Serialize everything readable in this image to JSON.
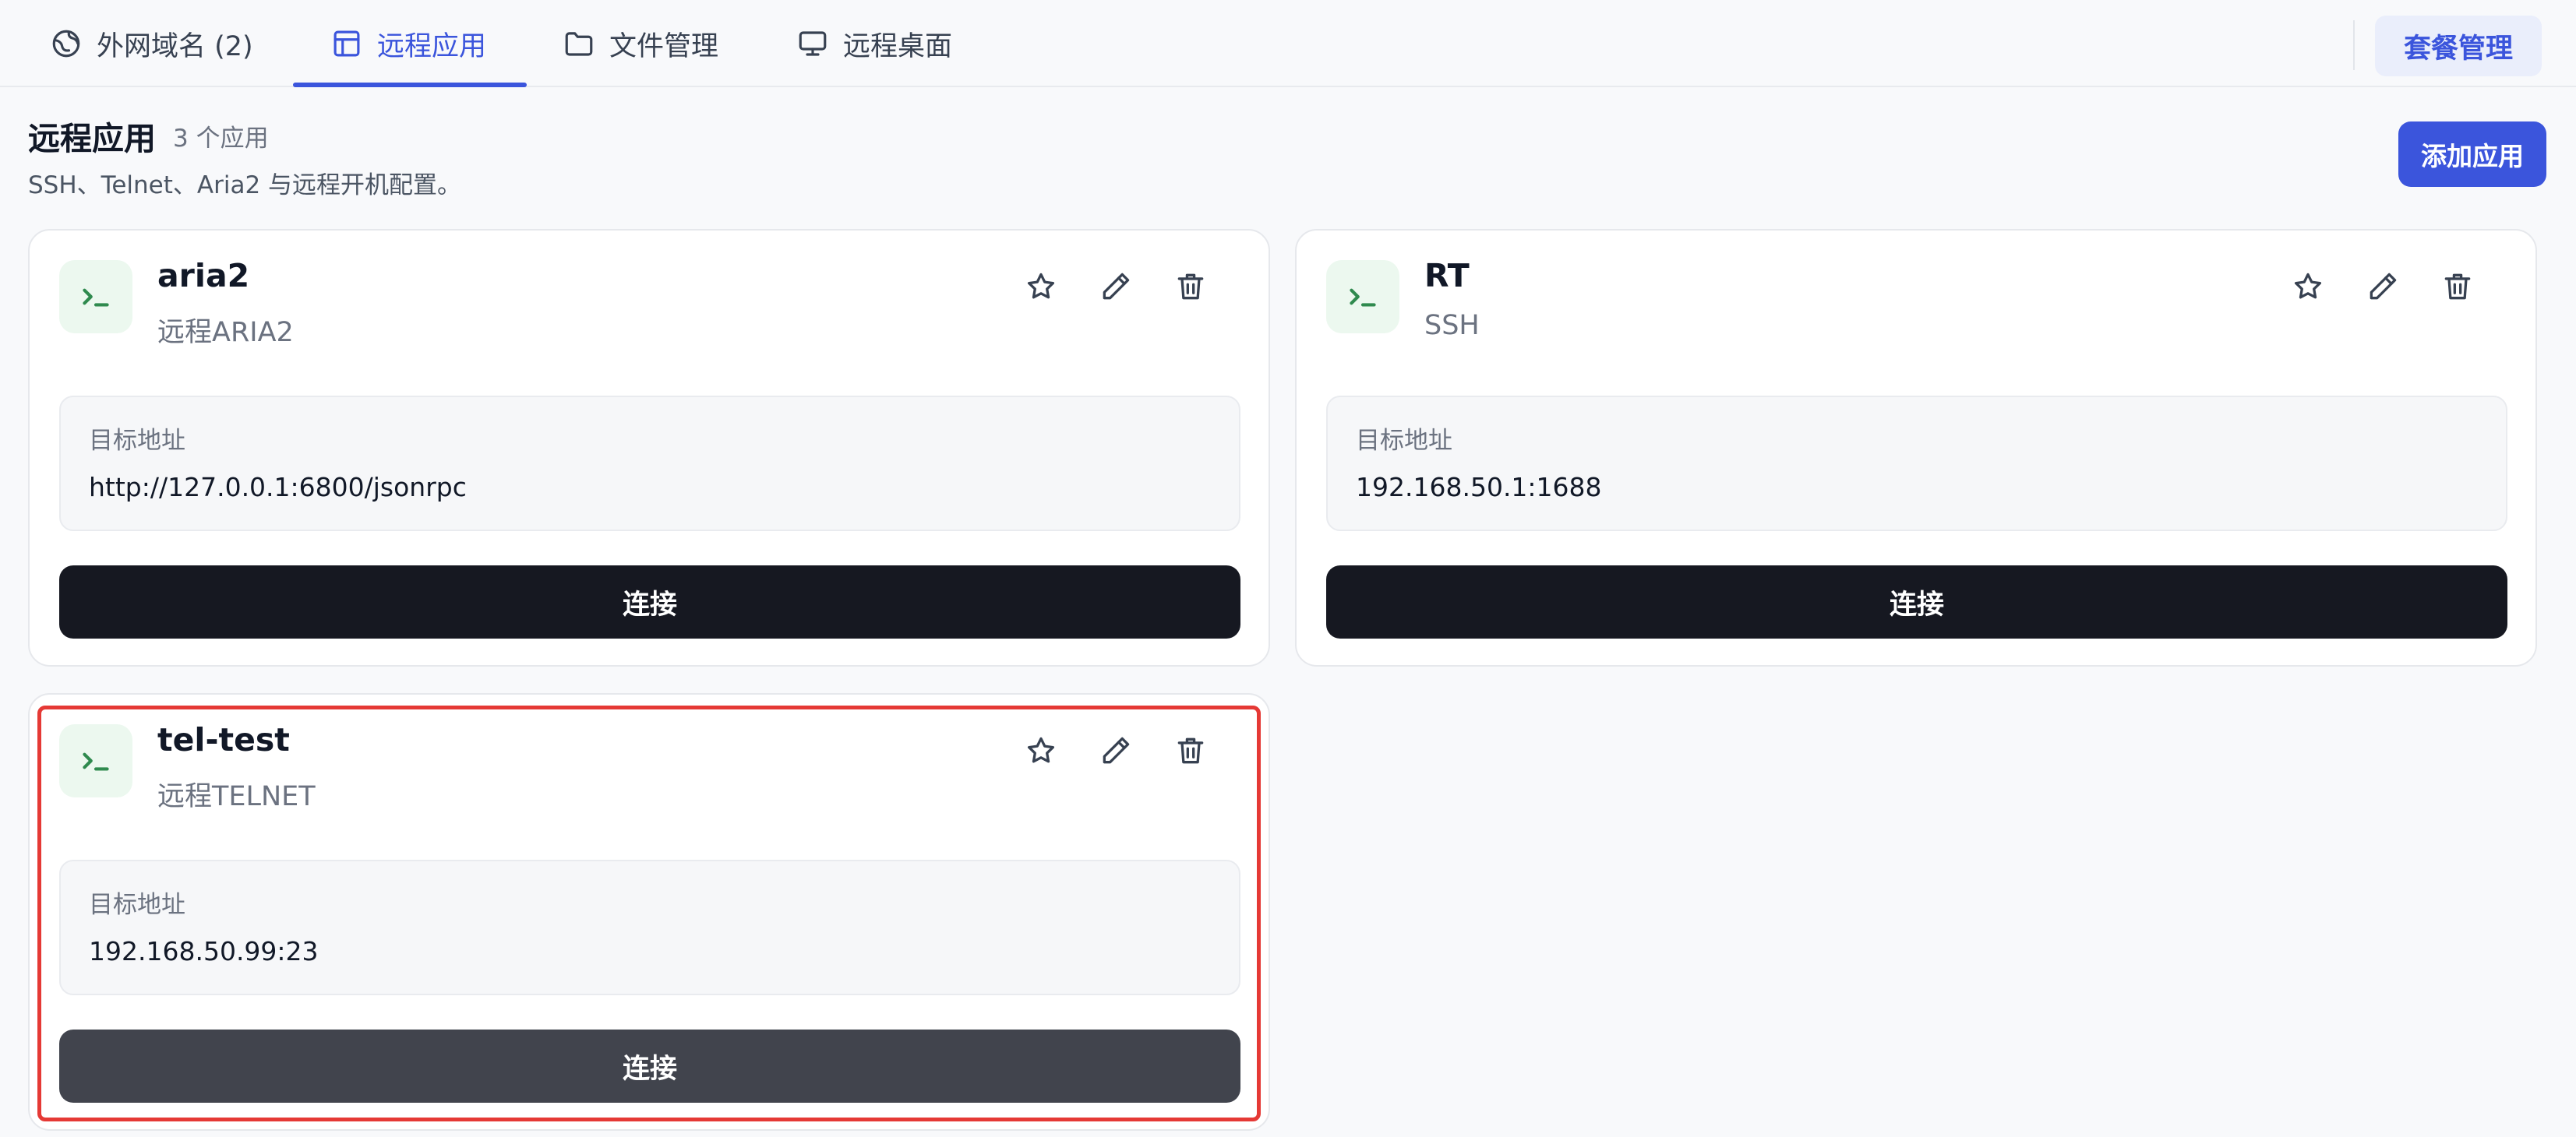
{
  "tabs": [
    {
      "label": "外网域名 (2)",
      "icon": "globe-icon"
    },
    {
      "label": "远程应用",
      "icon": "layout-icon"
    },
    {
      "label": "文件管理",
      "icon": "folder-icon"
    },
    {
      "label": "远程桌面",
      "icon": "monitor-icon"
    }
  ],
  "active_tab": "远程应用",
  "plan_button": "套餐管理",
  "page": {
    "title": "远程应用",
    "count": "3 个应用",
    "description": "SSH、Telnet、Aria2 与远程开机配置。",
    "add_button": "添加应用"
  },
  "target_label": "目标地址",
  "connect_label": "连接",
  "apps": [
    {
      "name": "aria2",
      "type": "远程ARIA2",
      "target": "http://127.0.0.1:6800/jsonrpc"
    },
    {
      "name": "RT",
      "type": "SSH",
      "target": "192.168.50.1:1688"
    },
    {
      "name": "tel-test",
      "type": "远程TELNET",
      "target": "192.168.50.99:23"
    }
  ],
  "colors": {
    "accent": "#3b55dc",
    "connect_button": "#161821",
    "connect_button_hover": "#41444d",
    "highlight_border": "#e53935",
    "terminal_icon": "#2f8a4e"
  }
}
